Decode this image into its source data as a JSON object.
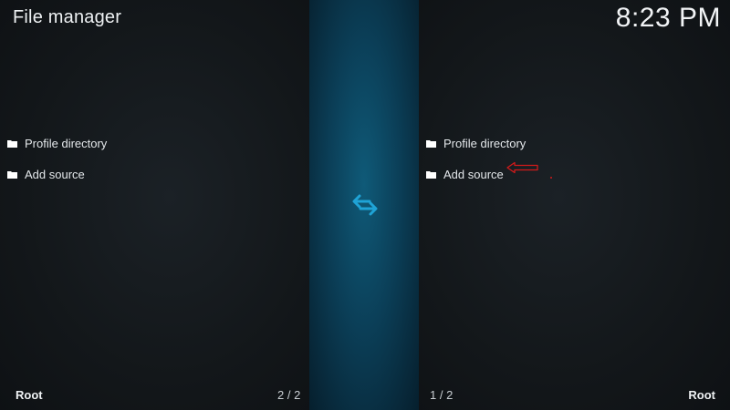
{
  "header": {
    "title": "File manager",
    "clock": "8:23 PM"
  },
  "left_pane": {
    "items": [
      {
        "label": "Profile directory",
        "icon": "folder-icon"
      },
      {
        "label": "Add source",
        "icon": "folder-icon"
      }
    ],
    "footer_path": "Root",
    "footer_count": "2 / 2"
  },
  "right_pane": {
    "items": [
      {
        "label": "Profile directory",
        "icon": "folder-icon"
      },
      {
        "label": "Add source",
        "icon": "folder-icon"
      }
    ],
    "footer_path": "Root",
    "footer_count": "1 / 2"
  },
  "divider": {
    "icon": "swap-arrows-icon",
    "color": "#1fa3d6"
  },
  "annotation": {
    "icon": "red-arrow-annotation",
    "color": "#d21a1a"
  }
}
